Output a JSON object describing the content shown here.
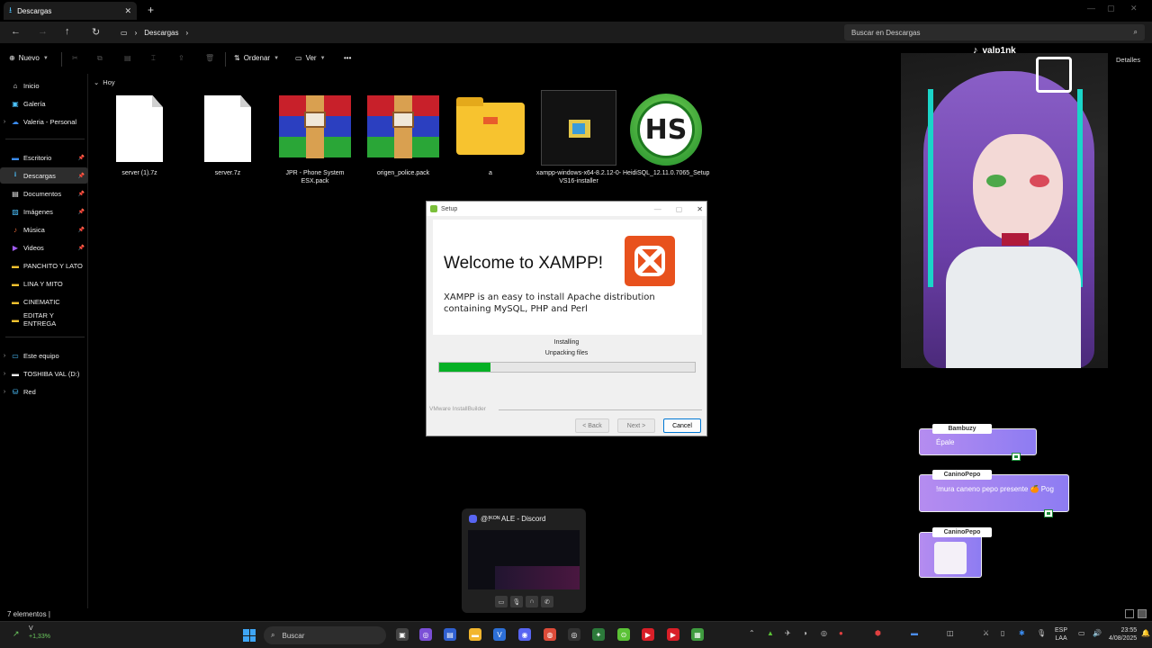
{
  "window": {
    "tab_title": "Descargas",
    "new_tab": "+",
    "close": "✕"
  },
  "address": {
    "path": "Descargas",
    "search_placeholder": "Buscar en Descargas"
  },
  "toolbar": {
    "new_label": "Nuevo",
    "sort_label": "Ordenar",
    "view_label": "Ver",
    "more": "•••",
    "details_label": "Detalles"
  },
  "sidebar": {
    "items": [
      {
        "label": "Inicio",
        "icon": "home-icon"
      },
      {
        "label": "Galería",
        "icon": "gallery-icon"
      },
      {
        "label": "Valeria - Personal",
        "icon": "cloud-icon"
      },
      {
        "label": "Escritorio",
        "icon": "desktop-icon"
      },
      {
        "label": "Descargas",
        "icon": "download-icon"
      },
      {
        "label": "Documentos",
        "icon": "documents-icon"
      },
      {
        "label": "Imágenes",
        "icon": "images-icon"
      },
      {
        "label": "Música",
        "icon": "music-icon"
      },
      {
        "label": "Videos",
        "icon": "videos-icon"
      },
      {
        "label": "PANCHITO Y LATO",
        "icon": "folder-icon"
      },
      {
        "label": "LINA Y MITO",
        "icon": "folder-icon"
      },
      {
        "label": "CINEMATIC",
        "icon": "folder-icon"
      },
      {
        "label": "EDITAR Y ENTREGA",
        "icon": "folder-icon"
      },
      {
        "label": "Este equipo",
        "icon": "pc-icon"
      },
      {
        "label": "TOSHIBA VAL (D:)",
        "icon": "drive-icon"
      },
      {
        "label": "Red",
        "icon": "network-icon"
      }
    ]
  },
  "files": {
    "group": "Hoy",
    "items": [
      {
        "name": "server (1).7z",
        "type": "doc"
      },
      {
        "name": "server.7z",
        "type": "doc"
      },
      {
        "name": "JPR - Phone System ESX.pack",
        "type": "rar"
      },
      {
        "name": "origen_police.pack",
        "type": "rar"
      },
      {
        "name": "a",
        "type": "folder"
      },
      {
        "name": "xampp-windows-x64-8.2.12-0-VS16-installer",
        "type": "installer"
      },
      {
        "name": "HeidiSQL_12.11.0.7065_Setup",
        "type": "heidi"
      }
    ]
  },
  "status": {
    "count": "7 elementos",
    "sep": "|"
  },
  "setup": {
    "title": "Setup",
    "welcome": "Welcome to XAMPP!",
    "description": "XAMPP is an easy to install Apache distribution containing MySQL, PHP and Perl",
    "installing": "Installing",
    "step": "Unpacking files",
    "progress": 0.2,
    "brand": "VMware InstallBuilder",
    "back": "< Back",
    "next": "Next >",
    "cancel": "Cancel"
  },
  "stream": {
    "handle": "valp1nk",
    "chats": [
      {
        "user": "Bambuzy",
        "message": "Épale"
      },
      {
        "user": "CaninoPepo",
        "message": "!mura caneno pepo presente 🍊 Pog"
      },
      {
        "user": "CaninoPepo",
        "message": ""
      }
    ]
  },
  "discord_preview": {
    "title": "@!ᴷᴼᴺ ALE - Discord"
  },
  "taskbar": {
    "stock_name": "V",
    "stock_change": "+1,33%",
    "search_label": "Buscar",
    "lang_top": "ESP",
    "lang_bottom": "LAA",
    "time": "23:55",
    "date": "4/08/2025"
  }
}
